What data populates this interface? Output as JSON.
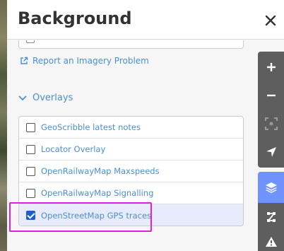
{
  "panel": {
    "title": "Background",
    "report_link": "Report an Imagery Problem",
    "overlays_heading": "Overlays",
    "overlays": [
      {
        "label": "GeoScribble latest notes",
        "checked": false
      },
      {
        "label": "Locator Overlay",
        "checked": false
      },
      {
        "label": "OpenRailwayMap Maxspeeds",
        "checked": false
      },
      {
        "label": "OpenRailwayMap Signalling",
        "checked": false
      },
      {
        "label": "OpenStreetMap GPS traces",
        "checked": true
      }
    ]
  },
  "toolbar": {
    "buttons": [
      "zoom-in-icon",
      "zoom-out-icon",
      "zoom-to-selection-icon",
      "geolocate-icon",
      "layers-icon",
      "map-data-icon",
      "issues-icon"
    ]
  },
  "colors": {
    "accent": "#7092ff",
    "link": "#4a8fd1",
    "highlight": "#e020e0",
    "checkbox": "#1a5fd0"
  }
}
